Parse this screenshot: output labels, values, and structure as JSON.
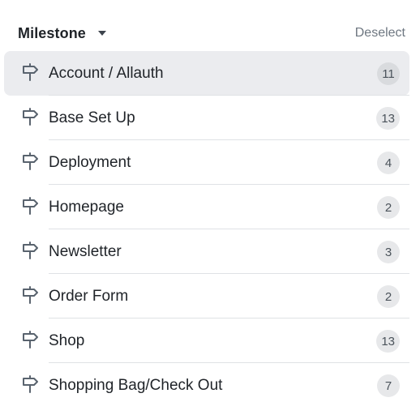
{
  "header": {
    "title": "Milestone",
    "deselect_label": "Deselect"
  },
  "icons": {
    "dropdown": "triangle-down-icon",
    "milestone": "milestone-signpost-icon"
  },
  "colors": {
    "active_row_bg": "#ebecef",
    "badge_bg": "#e7e8ea",
    "muted_text": "#6e7781"
  },
  "milestones": [
    {
      "name": "Account / Allauth",
      "count": "11",
      "selected": true
    },
    {
      "name": "Base Set Up",
      "count": "13",
      "selected": false
    },
    {
      "name": "Deployment",
      "count": "4",
      "selected": false
    },
    {
      "name": "Homepage",
      "count": "2",
      "selected": false
    },
    {
      "name": "Newsletter",
      "count": "3",
      "selected": false
    },
    {
      "name": "Order Form",
      "count": "2",
      "selected": false
    },
    {
      "name": "Shop",
      "count": "13",
      "selected": false
    },
    {
      "name": "Shopping Bag/Check Out",
      "count": "7",
      "selected": false
    }
  ]
}
